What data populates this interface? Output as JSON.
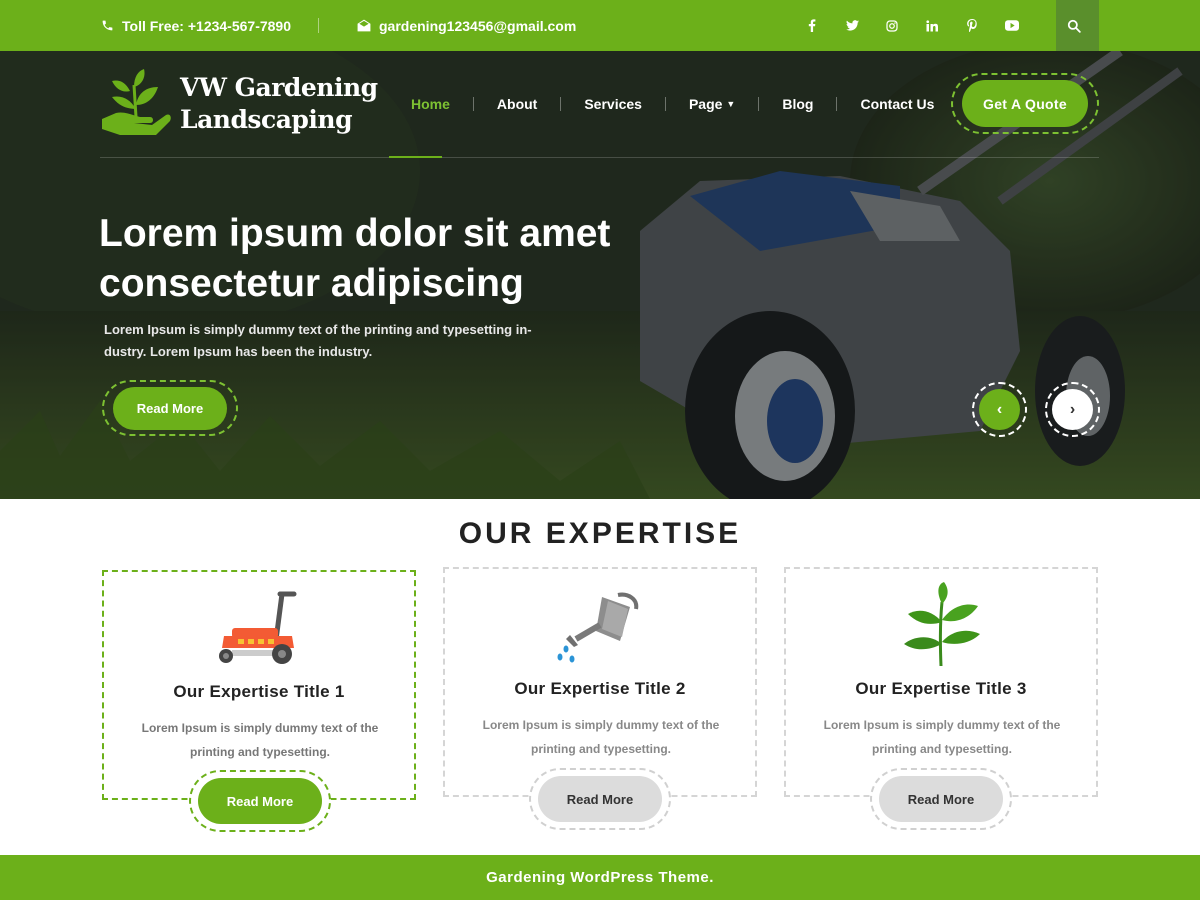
{
  "topbar": {
    "phone": "Toll Free: +1234-567-7890",
    "email": "gardening123456@gmail.com",
    "socials": [
      {
        "icon": "facebook-icon",
        "glyph": "f"
      },
      {
        "icon": "twitter-icon",
        "glyph": "t"
      },
      {
        "icon": "instagram-icon",
        "glyph": "ig"
      },
      {
        "icon": "linkedin-icon",
        "glyph": "in"
      },
      {
        "icon": "pinterest-icon",
        "glyph": "p"
      },
      {
        "icon": "youtube-icon",
        "glyph": "yt"
      }
    ],
    "search_icon": "search-icon"
  },
  "header": {
    "logo_line1": "VW Gardening",
    "logo_line2": "Landscaping",
    "nav": [
      "Home",
      "About",
      "Services",
      "Page",
      "Blog",
      "Contact Us"
    ],
    "active_nav": "Home",
    "quote_button": "Get A Quote"
  },
  "hero": {
    "title": "Lorem ipsum dolor sit amet consectetur adipiscing",
    "text": "Lorem Ipsum is simply dummy text of the printing and typesetting in-dustry. Lorem Ipsum has been the industry.",
    "read_more": "Read More",
    "prev_icon": "chevron-left-icon",
    "next_icon": "chevron-right-icon"
  },
  "expertise": {
    "title": "OUR EXPERTISE",
    "cards": [
      {
        "title": "Our Expertise Title 1",
        "text": "Lorem Ipsum is simply dummy text of the printing and typesetting.",
        "button": "Read More",
        "icon": "lawn-mower-icon"
      },
      {
        "title": "Our Expertise Title 2",
        "text": "Lorem Ipsum is simply dummy text of the printing and typesetting.",
        "button": "Read More",
        "icon": "watering-can-icon"
      },
      {
        "title": "Our Expertise Title 3",
        "text": "Lorem Ipsum is simply dummy text of the printing and typesetting.",
        "button": "Read More",
        "icon": "plant-sprout-icon"
      }
    ]
  },
  "footer": {
    "text": "Gardening WordPress Theme."
  },
  "colors": {
    "accent": "#6cb01a",
    "accent_light": "#7dc132",
    "search_bg": "#5a8f2c"
  }
}
